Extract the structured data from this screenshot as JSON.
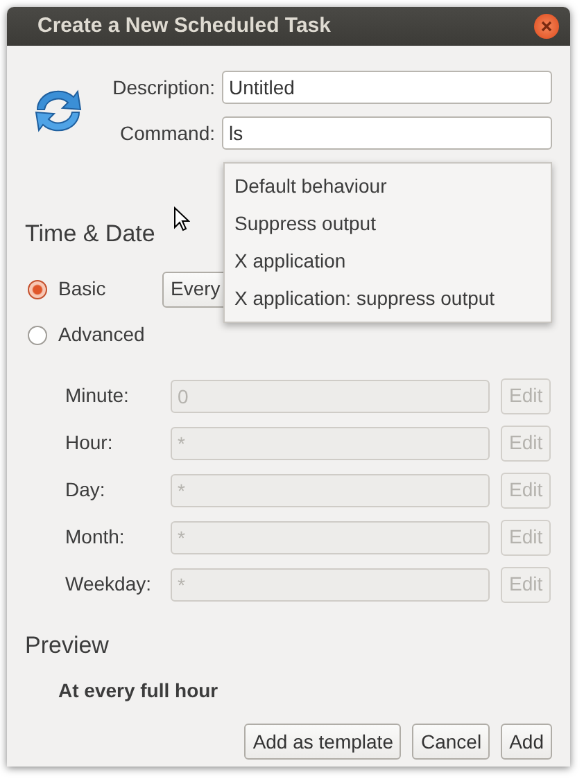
{
  "window": {
    "title": "Create a New Scheduled Task"
  },
  "description": {
    "label": "Description:",
    "value": "Untitled"
  },
  "command": {
    "label": "Command:",
    "value": "ls"
  },
  "command_menu": {
    "items": [
      {
        "label": "Default behaviour"
      },
      {
        "label": "Suppress output"
      },
      {
        "label": "X application"
      },
      {
        "label": "X application: suppress output"
      }
    ]
  },
  "time_date": {
    "heading": "Time & Date",
    "modes": [
      {
        "label": "Basic",
        "selected": true
      },
      {
        "label": "Advanced",
        "selected": false
      }
    ],
    "basic_value": "Every",
    "fields": [
      {
        "label": "Minute:",
        "value": "0",
        "button": "Edit",
        "disabled": true
      },
      {
        "label": "Hour:",
        "value": "*",
        "button": "Edit",
        "disabled": true
      },
      {
        "label": "Day:",
        "value": "*",
        "button": "Edit",
        "disabled": true
      },
      {
        "label": "Month:",
        "value": "*",
        "button": "Edit",
        "disabled": true
      },
      {
        "label": "Weekday:",
        "value": "*",
        "button": "Edit",
        "disabled": true
      }
    ]
  },
  "preview": {
    "heading": "Preview",
    "text": "At every full hour"
  },
  "buttons": [
    "Add as template",
    "Cancel",
    "Add"
  ]
}
